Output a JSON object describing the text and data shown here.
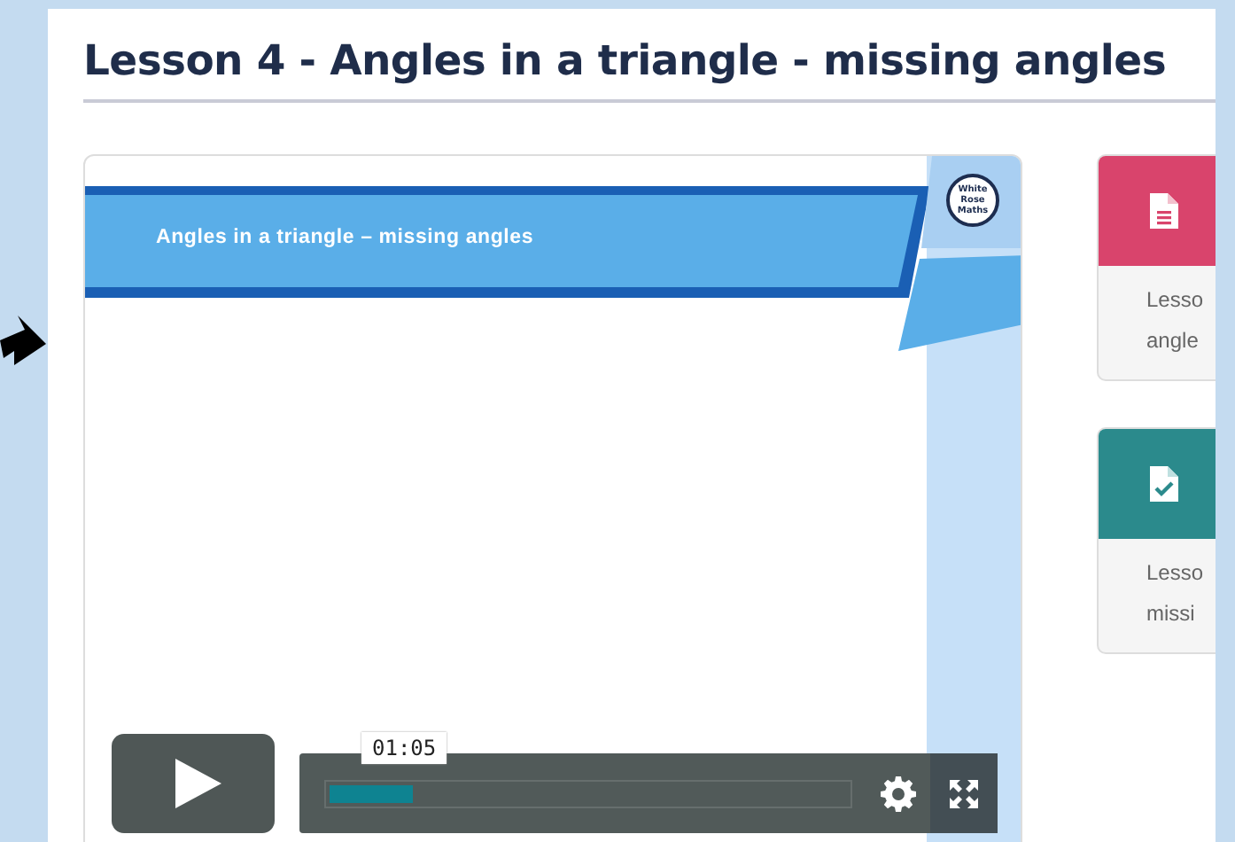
{
  "page": {
    "title": "Lesson 4 - Angles in a triangle - missing angles"
  },
  "video": {
    "slide_title": "Angles in a triangle – missing angles",
    "logo": [
      "White",
      "Rose",
      "Maths"
    ],
    "tooltip": "01:05",
    "progress": {
      "level": 0.16
    }
  },
  "cards": [
    {
      "kind": "document",
      "color": "#d9446c",
      "lines": [
        "Lesso",
        "angle"
      ]
    },
    {
      "kind": "checked-document",
      "color": "#2b8a8c",
      "lines": [
        "Lesso",
        "missi"
      ]
    }
  ]
}
